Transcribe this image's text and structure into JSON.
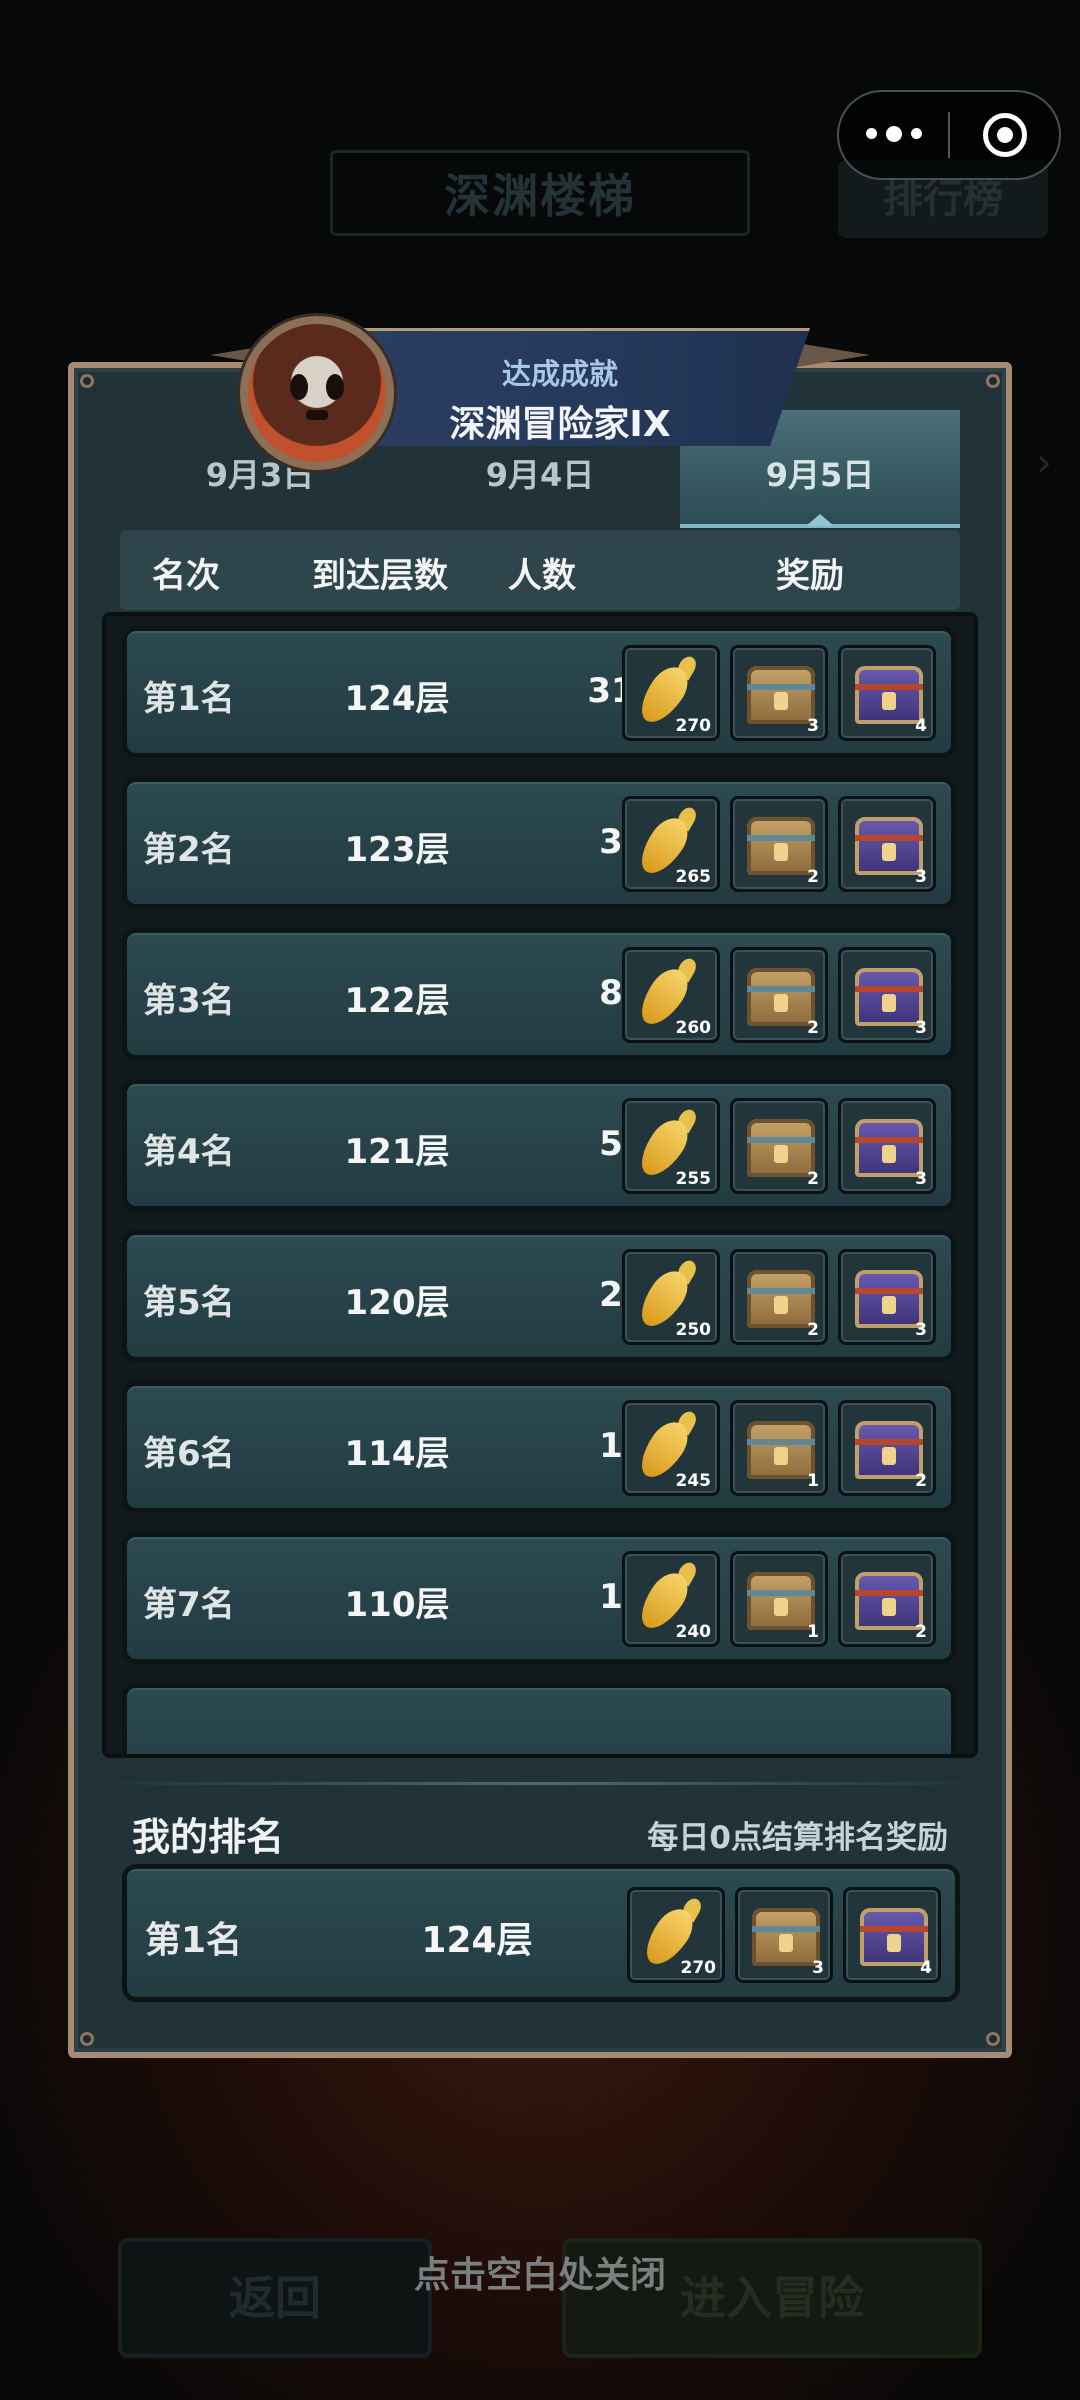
{
  "background": {
    "title": "深渊楼梯",
    "rank_button": "排行榜",
    "back_button": "返回",
    "enter_button": "进入冒险",
    "close_hint": "点击空白处关闭"
  },
  "achievement": {
    "label": "达成成就",
    "title": "深渊冒险家IX"
  },
  "tabs": [
    {
      "label": "9月3日",
      "active": false
    },
    {
      "label": "9月4日",
      "active": false
    },
    {
      "label": "9月5日",
      "active": true
    }
  ],
  "columns": {
    "rank": "名次",
    "floor": "到达层数",
    "count": "人数",
    "reward": "奖励"
  },
  "rows": [
    {
      "rank": "第1名",
      "floor": "124层",
      "count": "31",
      "rewards": [
        "270",
        "3",
        "4"
      ]
    },
    {
      "rank": "第2名",
      "floor": "123层",
      "count": "3",
      "rewards": [
        "265",
        "2",
        "3"
      ]
    },
    {
      "rank": "第3名",
      "floor": "122层",
      "count": "8",
      "rewards": [
        "260",
        "2",
        "3"
      ]
    },
    {
      "rank": "第4名",
      "floor": "121层",
      "count": "5",
      "rewards": [
        "255",
        "2",
        "3"
      ]
    },
    {
      "rank": "第5名",
      "floor": "120层",
      "count": "2",
      "rewards": [
        "250",
        "2",
        "3"
      ]
    },
    {
      "rank": "第6名",
      "floor": "114层",
      "count": "1",
      "rewards": [
        "245",
        "1",
        "2"
      ]
    },
    {
      "rank": "第7名",
      "floor": "110层",
      "count": "1",
      "rewards": [
        "240",
        "1",
        "2"
      ]
    }
  ],
  "reward_icons": [
    "carrot-icon",
    "gold-chest-icon",
    "purple-chest-icon"
  ],
  "my_rank": {
    "title": "我的排名",
    "note": "每日0点结算排名奖励",
    "rank": "第1名",
    "floor": "124层",
    "rewards": [
      "270",
      "3",
      "4"
    ]
  },
  "colors": {
    "panel": "#213338",
    "panel_border": "#a78a74",
    "row": "#2d4a51",
    "active_tab": "#4a6f78"
  }
}
